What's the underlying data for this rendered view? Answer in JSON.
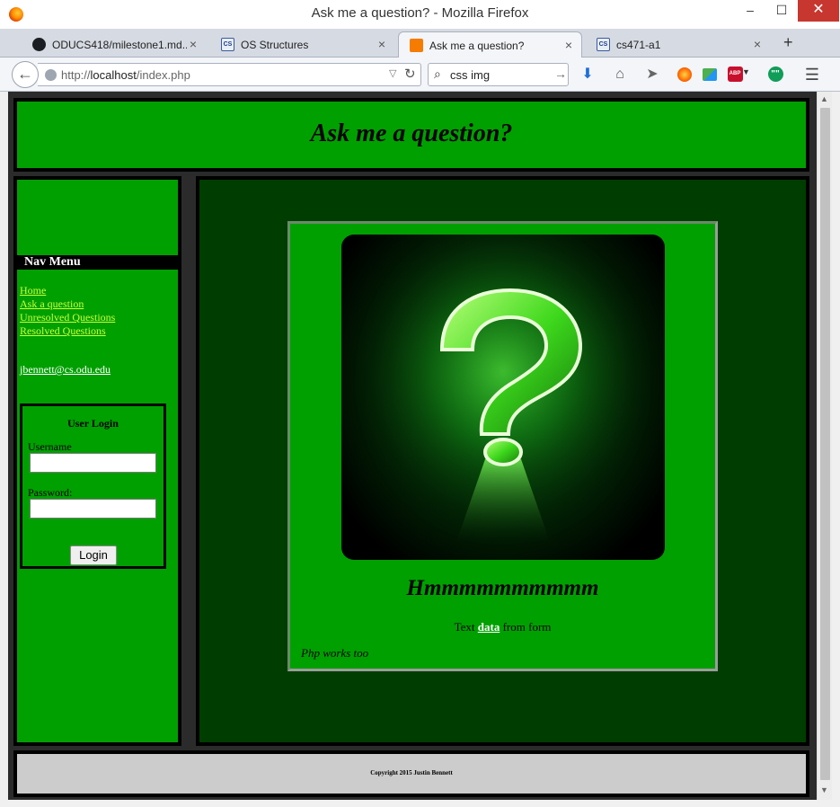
{
  "window": {
    "title": "Ask me a question? - Mozilla Firefox",
    "min_glyph": "–",
    "max_glyph": "☐",
    "close_glyph": "✕"
  },
  "tabs": [
    {
      "label": "ODUCS418/milestone1.md...",
      "icon": "github-icon",
      "active": false
    },
    {
      "label": "OS Structures",
      "icon": "cs-icon",
      "active": false
    },
    {
      "label": "Ask me a question?",
      "icon": "xampp-icon",
      "active": true
    },
    {
      "label": "cs471-a1",
      "icon": "cs-icon",
      "active": false
    }
  ],
  "tab_icon_text": "CS",
  "tab_close_glyph": "×",
  "new_tab_glyph": "+",
  "navbar": {
    "url_prefix": "http://",
    "url_host": "localhost",
    "url_path": "/index.php",
    "search_value": "css img",
    "abp_text": "ABP",
    "hangouts_text": "\"\""
  },
  "page": {
    "heading": "Ask me a question?",
    "nav_title": "Nav Menu",
    "nav_links": [
      "Home",
      "Ask a question",
      "Unresolved Questions",
      "Resolved Questions"
    ],
    "email": "jbennett@cs.odu.edu",
    "login": {
      "title": "User Login",
      "username_label": "Username",
      "password_label": "Password:",
      "username_value": "",
      "password_value": "",
      "button_label": "Login"
    },
    "card": {
      "heading": "Hmmmmmmmmmm",
      "text_before": "Text ",
      "text_link": "data",
      "text_after": " from form",
      "note": "Php works too"
    },
    "footer": "Copyright 2015 Justin Bennett"
  },
  "colors": {
    "page_green": "#00a000",
    "main_dark_green": "#003d00",
    "nav_link": "#c6ff3d",
    "footer_gray": "#cccccc",
    "close_red": "#c7372f"
  }
}
